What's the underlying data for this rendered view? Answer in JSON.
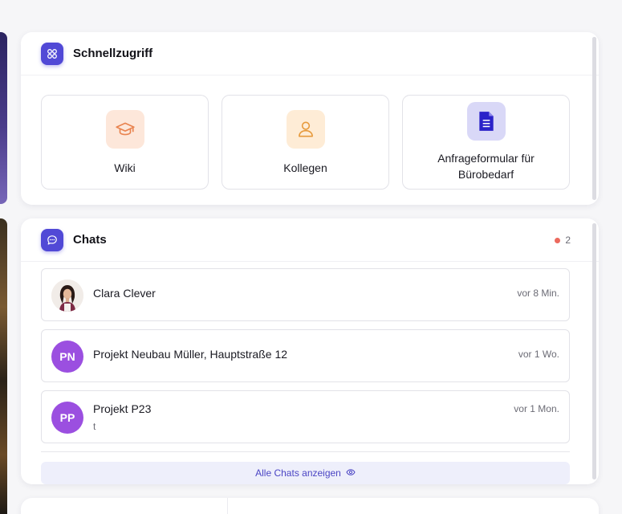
{
  "quick_access": {
    "title": "Schnellzugriff",
    "tiles": [
      {
        "label": "Wiki",
        "icon": "graduation-cap-icon",
        "bg": "#fde7da",
        "color": "#e9834f"
      },
      {
        "label": "Kollegen",
        "icon": "user-icon",
        "bg": "#feecd6",
        "color": "#e79a3c"
      },
      {
        "label": "Anfrageformular für Bürobedarf",
        "icon": "document-icon",
        "bg": "#d9d8f7",
        "color": "#2b22c9"
      }
    ]
  },
  "chats": {
    "title": "Chats",
    "unread_count": "2",
    "items": [
      {
        "name": "Clara Clever",
        "time": "vor 8 Min.",
        "initials": "",
        "preview": ""
      },
      {
        "name": "Projekt Neubau Müller, Hauptstraße 12",
        "time": "vor 1 Wo.",
        "initials": "PN",
        "preview": ""
      },
      {
        "name": "Projekt P23",
        "time": "vor 1 Mon.",
        "initials": "PP",
        "preview": "t"
      }
    ],
    "show_all_label": "Alle Chats anzeigen"
  },
  "colors": {
    "accent": "#5149d6",
    "avatar": "#9b4fe0",
    "unread_dot": "#ec6a5e",
    "link": "#4b45c4"
  }
}
